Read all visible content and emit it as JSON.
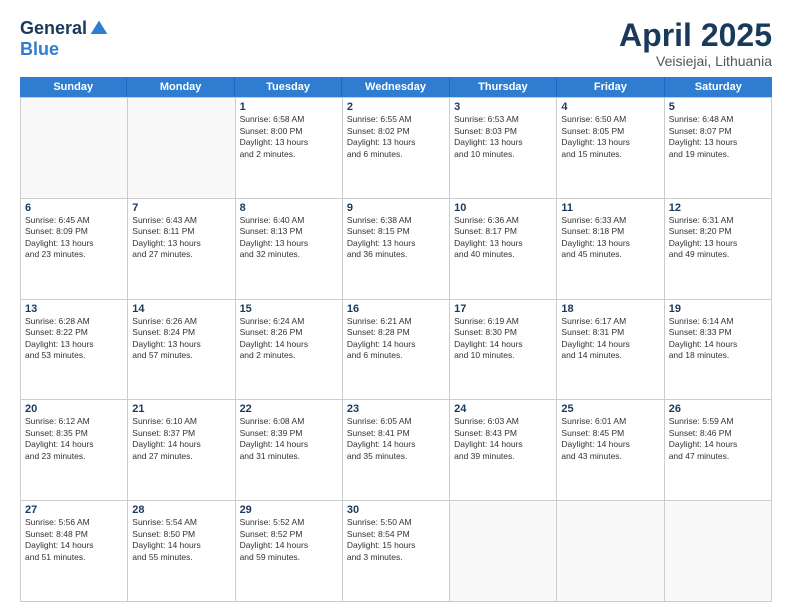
{
  "logo": {
    "general": "General",
    "blue": "Blue"
  },
  "title": "April 2025",
  "location": "Veisiejai, Lithuania",
  "weekdays": [
    "Sunday",
    "Monday",
    "Tuesday",
    "Wednesday",
    "Thursday",
    "Friday",
    "Saturday"
  ],
  "weeks": [
    [
      {
        "day": "",
        "info": ""
      },
      {
        "day": "",
        "info": ""
      },
      {
        "day": "1",
        "info": "Sunrise: 6:58 AM\nSunset: 8:00 PM\nDaylight: 13 hours\nand 2 minutes."
      },
      {
        "day": "2",
        "info": "Sunrise: 6:55 AM\nSunset: 8:02 PM\nDaylight: 13 hours\nand 6 minutes."
      },
      {
        "day": "3",
        "info": "Sunrise: 6:53 AM\nSunset: 8:03 PM\nDaylight: 13 hours\nand 10 minutes."
      },
      {
        "day": "4",
        "info": "Sunrise: 6:50 AM\nSunset: 8:05 PM\nDaylight: 13 hours\nand 15 minutes."
      },
      {
        "day": "5",
        "info": "Sunrise: 6:48 AM\nSunset: 8:07 PM\nDaylight: 13 hours\nand 19 minutes."
      }
    ],
    [
      {
        "day": "6",
        "info": "Sunrise: 6:45 AM\nSunset: 8:09 PM\nDaylight: 13 hours\nand 23 minutes."
      },
      {
        "day": "7",
        "info": "Sunrise: 6:43 AM\nSunset: 8:11 PM\nDaylight: 13 hours\nand 27 minutes."
      },
      {
        "day": "8",
        "info": "Sunrise: 6:40 AM\nSunset: 8:13 PM\nDaylight: 13 hours\nand 32 minutes."
      },
      {
        "day": "9",
        "info": "Sunrise: 6:38 AM\nSunset: 8:15 PM\nDaylight: 13 hours\nand 36 minutes."
      },
      {
        "day": "10",
        "info": "Sunrise: 6:36 AM\nSunset: 8:17 PM\nDaylight: 13 hours\nand 40 minutes."
      },
      {
        "day": "11",
        "info": "Sunrise: 6:33 AM\nSunset: 8:18 PM\nDaylight: 13 hours\nand 45 minutes."
      },
      {
        "day": "12",
        "info": "Sunrise: 6:31 AM\nSunset: 8:20 PM\nDaylight: 13 hours\nand 49 minutes."
      }
    ],
    [
      {
        "day": "13",
        "info": "Sunrise: 6:28 AM\nSunset: 8:22 PM\nDaylight: 13 hours\nand 53 minutes."
      },
      {
        "day": "14",
        "info": "Sunrise: 6:26 AM\nSunset: 8:24 PM\nDaylight: 13 hours\nand 57 minutes."
      },
      {
        "day": "15",
        "info": "Sunrise: 6:24 AM\nSunset: 8:26 PM\nDaylight: 14 hours\nand 2 minutes."
      },
      {
        "day": "16",
        "info": "Sunrise: 6:21 AM\nSunset: 8:28 PM\nDaylight: 14 hours\nand 6 minutes."
      },
      {
        "day": "17",
        "info": "Sunrise: 6:19 AM\nSunset: 8:30 PM\nDaylight: 14 hours\nand 10 minutes."
      },
      {
        "day": "18",
        "info": "Sunrise: 6:17 AM\nSunset: 8:31 PM\nDaylight: 14 hours\nand 14 minutes."
      },
      {
        "day": "19",
        "info": "Sunrise: 6:14 AM\nSunset: 8:33 PM\nDaylight: 14 hours\nand 18 minutes."
      }
    ],
    [
      {
        "day": "20",
        "info": "Sunrise: 6:12 AM\nSunset: 8:35 PM\nDaylight: 14 hours\nand 23 minutes."
      },
      {
        "day": "21",
        "info": "Sunrise: 6:10 AM\nSunset: 8:37 PM\nDaylight: 14 hours\nand 27 minutes."
      },
      {
        "day": "22",
        "info": "Sunrise: 6:08 AM\nSunset: 8:39 PM\nDaylight: 14 hours\nand 31 minutes."
      },
      {
        "day": "23",
        "info": "Sunrise: 6:05 AM\nSunset: 8:41 PM\nDaylight: 14 hours\nand 35 minutes."
      },
      {
        "day": "24",
        "info": "Sunrise: 6:03 AM\nSunset: 8:43 PM\nDaylight: 14 hours\nand 39 minutes."
      },
      {
        "day": "25",
        "info": "Sunrise: 6:01 AM\nSunset: 8:45 PM\nDaylight: 14 hours\nand 43 minutes."
      },
      {
        "day": "26",
        "info": "Sunrise: 5:59 AM\nSunset: 8:46 PM\nDaylight: 14 hours\nand 47 minutes."
      }
    ],
    [
      {
        "day": "27",
        "info": "Sunrise: 5:56 AM\nSunset: 8:48 PM\nDaylight: 14 hours\nand 51 minutes."
      },
      {
        "day": "28",
        "info": "Sunrise: 5:54 AM\nSunset: 8:50 PM\nDaylight: 14 hours\nand 55 minutes."
      },
      {
        "day": "29",
        "info": "Sunrise: 5:52 AM\nSunset: 8:52 PM\nDaylight: 14 hours\nand 59 minutes."
      },
      {
        "day": "30",
        "info": "Sunrise: 5:50 AM\nSunset: 8:54 PM\nDaylight: 15 hours\nand 3 minutes."
      },
      {
        "day": "",
        "info": ""
      },
      {
        "day": "",
        "info": ""
      },
      {
        "day": "",
        "info": ""
      }
    ]
  ]
}
